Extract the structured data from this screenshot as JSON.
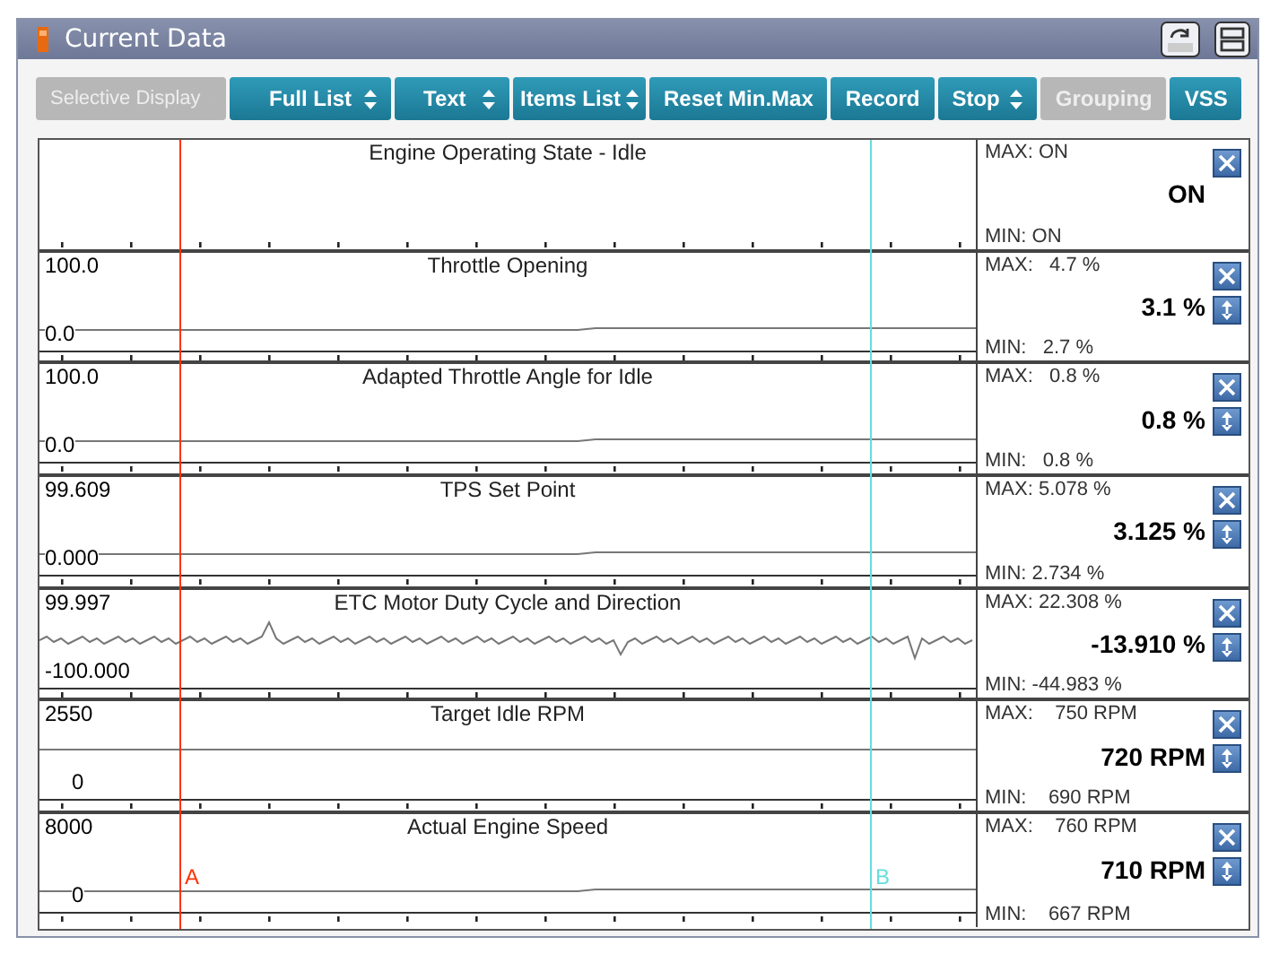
{
  "window": {
    "title": "Current Data"
  },
  "toolbar": [
    {
      "label": "Selective Display",
      "kind": "dropdown",
      "disabled": true
    },
    {
      "label": "Full List",
      "kind": "dropdown",
      "disabled": false
    },
    {
      "label": "Text",
      "kind": "dropdown",
      "disabled": false
    },
    {
      "label": "Items List",
      "kind": "dropdown",
      "disabled": false
    },
    {
      "label": "Reset Min.Max",
      "kind": "plain",
      "disabled": false
    },
    {
      "label": "Record",
      "kind": "plain",
      "disabled": false
    },
    {
      "label": "Stop",
      "kind": "dropdown",
      "disabled": false
    },
    {
      "label": "Grouping",
      "kind": "plain",
      "disabled": true
    },
    {
      "label": "VSS",
      "kind": "plain",
      "disabled": false
    }
  ],
  "cursors": [
    {
      "label": "A",
      "color": "#ff3300"
    },
    {
      "label": "B",
      "color": "#66dddd"
    }
  ],
  "rows": [
    {
      "title": "Engine Operating State - Idle",
      "kind": "state",
      "max": "MAX: ON",
      "value": "ON",
      "min": "MIN: ON",
      "reorder": false
    },
    {
      "title": "Throttle Opening",
      "y_max": "100.0",
      "y_min": "0.0",
      "kind": "low",
      "max": "MAX:   4.7 %",
      "value": "3.1 %",
      "min": "MIN:   2.7 %",
      "reorder": true
    },
    {
      "title": "Adapted Throttle Angle for Idle",
      "y_max": "100.0",
      "y_min": "0.0",
      "kind": "low",
      "max": "MAX:   0.8 %",
      "value": "0.8 %",
      "min": "MIN:   0.8 %",
      "reorder": true
    },
    {
      "title": "TPS Set Point",
      "y_max": "99.609",
      "y_min": "0.000",
      "kind": "low",
      "max": "MAX: 5.078 %",
      "value": "3.125 %",
      "min": "MIN: 2.734 %",
      "reorder": true
    },
    {
      "title": "ETC Motor Duty Cycle and Direction",
      "y_max": "99.997",
      "y_min": "-100.000",
      "kind": "noise",
      "max": "MAX: 22.308 %",
      "value": "-13.910 %",
      "min": "MIN: -44.983 %",
      "reorder": true
    },
    {
      "title": "Target Idle RPM",
      "y_max": "2550",
      "y_min": "0",
      "kind": "mid",
      "max": "MAX:    750 RPM",
      "value": "720 RPM",
      "min": "MIN:    690 RPM",
      "reorder": true
    },
    {
      "title": "Actual Engine Speed",
      "y_max": "8000",
      "y_min": "0",
      "kind": "low",
      "max": "MAX:    760 RPM",
      "value": "710 RPM",
      "min": "MIN:    667 RPM",
      "reorder": true
    }
  ]
}
